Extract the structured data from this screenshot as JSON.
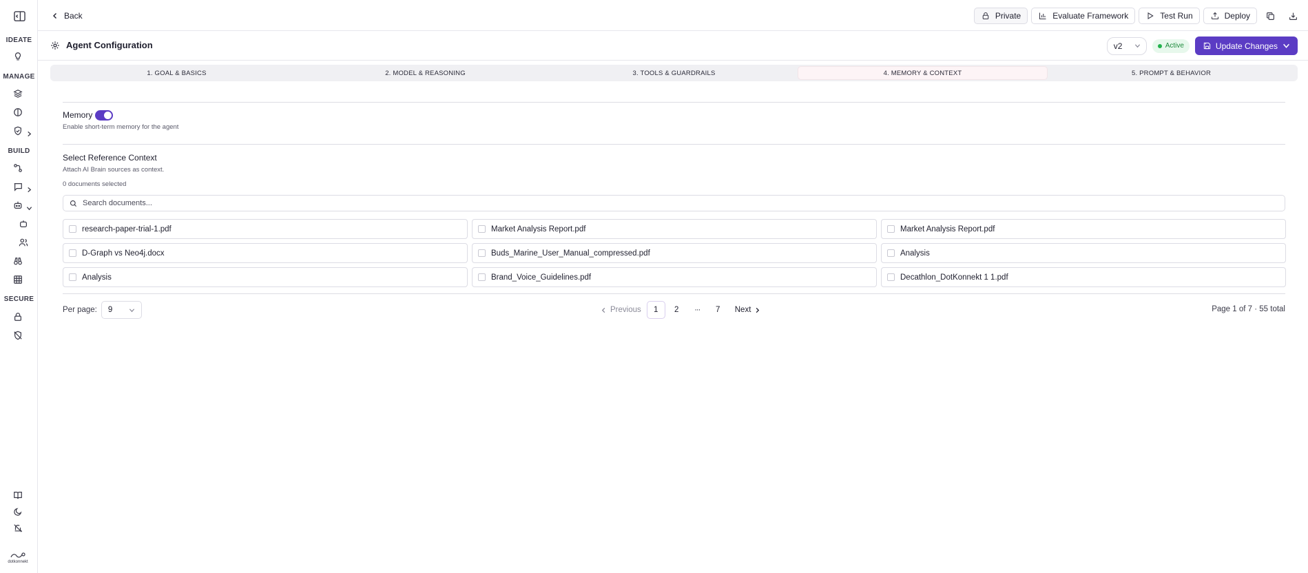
{
  "sidebar": {
    "sections": [
      "IDEATE",
      "MANAGE",
      "BUILD",
      "SECURE"
    ],
    "icons": {
      "toggle": "sidebar-toggle-icon",
      "ideate": [
        "lightbulb-icon"
      ],
      "manage": [
        "layers-icon",
        "brain-icon",
        "shield-check-icon"
      ],
      "build": [
        "workflow-icon",
        "chat-icon",
        "bot-icon",
        "bot-small-icon",
        "users-icon",
        "binoculars-icon",
        "table-icon"
      ],
      "secure": [
        "lock-icon",
        "shield-off-icon"
      ],
      "bottom": [
        "book-icon",
        "moon-icon",
        "bell-off-icon"
      ]
    },
    "logo_text": "dotkonnekt"
  },
  "topbar": {
    "back_label": "Back",
    "private_label": "Private",
    "evaluate_label": "Evaluate Framework",
    "test_run_label": "Test Run",
    "deploy_label": "Deploy"
  },
  "config": {
    "title": "Agent Configuration",
    "version": "v2",
    "status": "Active",
    "update_label": "Update Changes"
  },
  "tabs": [
    {
      "label": "1. GOAL & BASICS",
      "active": false
    },
    {
      "label": "2. MODEL & REASONING",
      "active": false
    },
    {
      "label": "3. TOOLS & GUARDRAILS",
      "active": false
    },
    {
      "label": "4. MEMORY & CONTEXT",
      "active": true
    },
    {
      "label": "5. PROMPT & BEHAVIOR",
      "active": false
    }
  ],
  "memory": {
    "label": "Memory",
    "enabled": true,
    "description": "Enable short-term memory for the agent"
  },
  "reference": {
    "title": "Select Reference Context",
    "description": "Attach AI Brain sources as context.",
    "selected_count": "0 documents selected",
    "search_placeholder": "Search documents...",
    "documents": [
      "research-paper-trial-1.pdf",
      "Market Analysis Report.pdf",
      "Market Analysis Report.pdf",
      "D-Graph vs Neo4j.docx",
      "Buds_Marine_User_Manual_compressed.pdf",
      "Analysis",
      "Analysis",
      "Brand_Voice_Guidelines.pdf",
      "Decathlon_DotKonnekt 1 1.pdf"
    ]
  },
  "pagination": {
    "per_page_label": "Per page:",
    "per_page_value": "9",
    "previous_label": "Previous",
    "next_label": "Next",
    "pages": [
      "1",
      "2",
      "···",
      "7"
    ],
    "current_page": "1",
    "summary": "Page 1 of 7 · 55 total"
  },
  "colors": {
    "accent": "#5b3cc4",
    "status_green": "#22b24c"
  }
}
